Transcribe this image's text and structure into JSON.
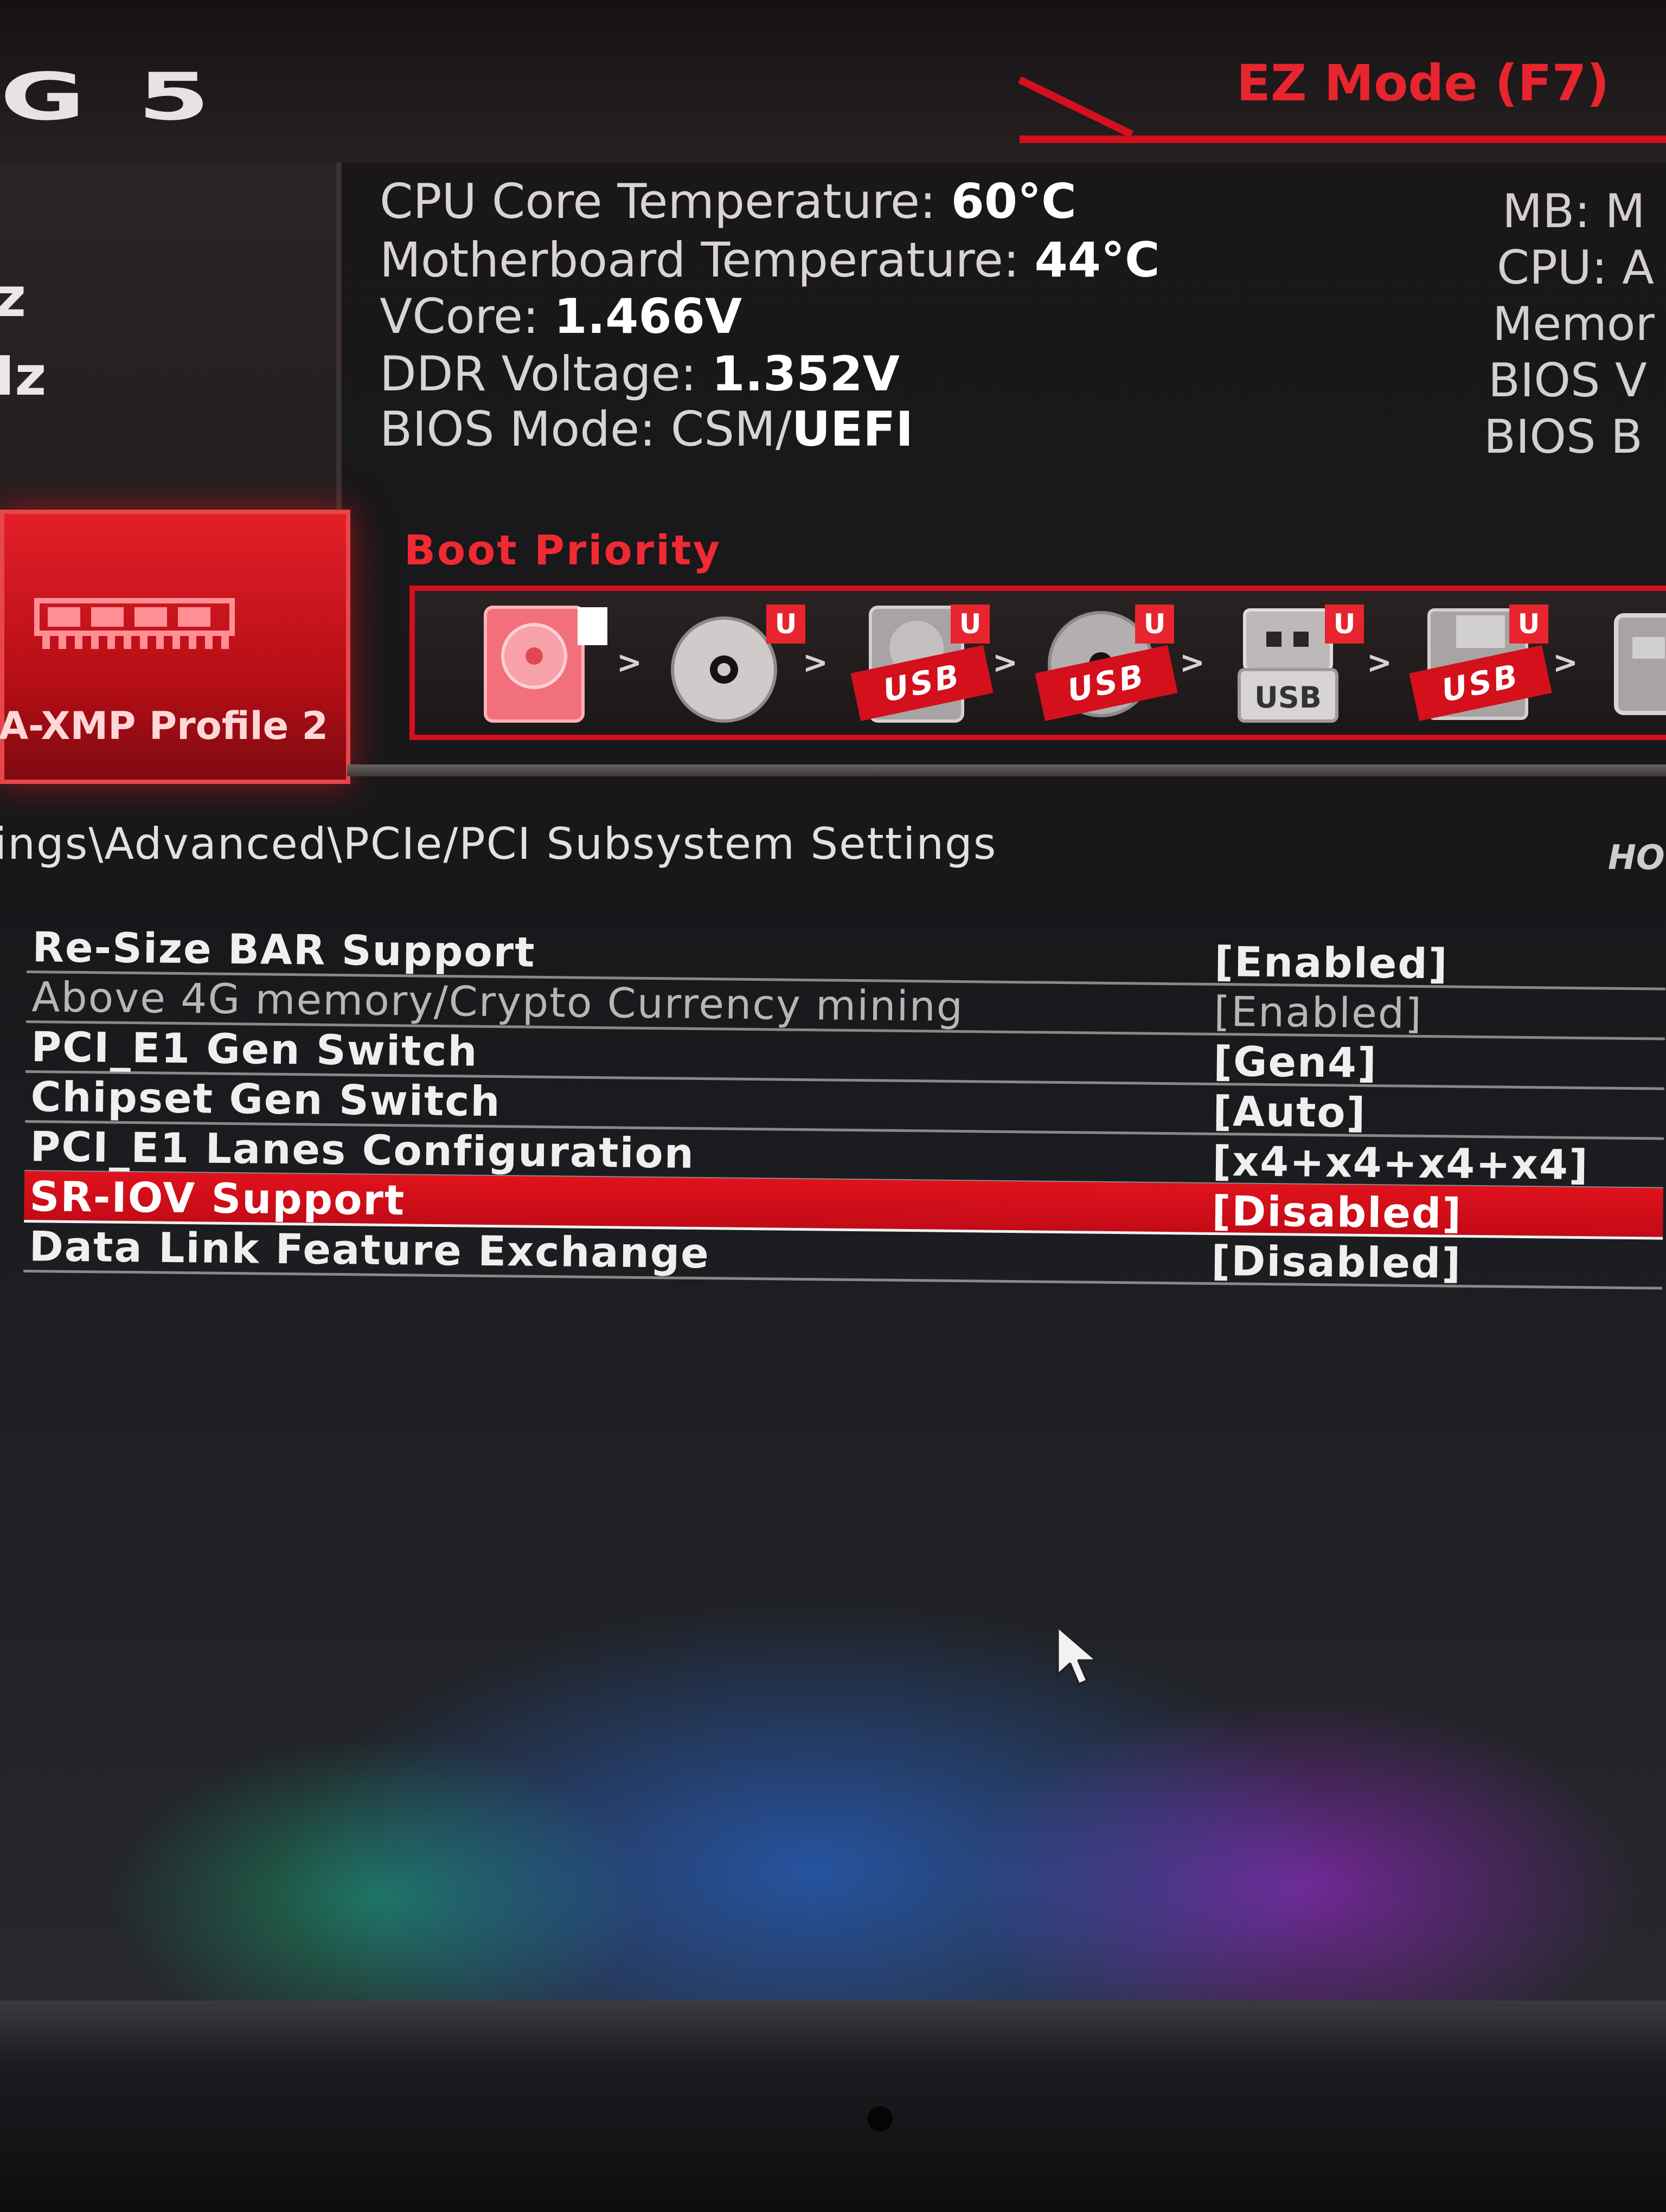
{
  "header": {
    "logo_text": "5",
    "logo_partial": "G",
    "ez_mode": "EZ Mode (F7)"
  },
  "left_panel": {
    "fragment_1": "z",
    "fragment_2": "Iz",
    "xmp_profile": "A-XMP Profile 2",
    "ram_icon": "memory-module-icon"
  },
  "system_info": {
    "cpu_temp_label": "CPU Core Temperature:",
    "cpu_temp_value": "60°C",
    "mb_temp_label": "Motherboard Temperature:",
    "mb_temp_value": "44°C",
    "vcore_label": "VCore:",
    "vcore_value": "1.466V",
    "ddr_label": "DDR Voltage:",
    "ddr_value": "1.352V",
    "bios_mode_label": "BIOS Mode:",
    "bios_mode_value": "CSM/",
    "bios_mode_value_bold": "UEFI"
  },
  "system_info_right": [
    "MB: M",
    "CPU: A",
    "Memor",
    "BIOS V",
    "BIOS B"
  ],
  "boot_priority": {
    "title": "Boot Priority",
    "devices": [
      {
        "icon": "hard-disk-icon",
        "label": ""
      },
      {
        "icon": "optical-disc-icon",
        "label": "",
        "badge": "U"
      },
      {
        "icon": "usb-hard-disk-icon",
        "label": "USB",
        "badge": "U"
      },
      {
        "icon": "usb-optical-disc-icon",
        "label": "USB",
        "badge": "U"
      },
      {
        "icon": "usb-key-icon",
        "label": "USB",
        "badge": "U"
      },
      {
        "icon": "usb-floppy-icon",
        "label": "USB",
        "badge": "U"
      },
      {
        "icon": "network-icon",
        "label": ""
      }
    ],
    "arrow": ">"
  },
  "breadcrumb": "ings\\Advanced\\PCIe/PCI Subsystem Settings",
  "hotkey": "HO",
  "settings": [
    {
      "label": "Re-Size BAR Support",
      "value": "[Enabled]"
    },
    {
      "label": "Above 4G memory/Crypto Currency mining",
      "value": "[Enabled]"
    },
    {
      "label": "PCI_E1 Gen Switch",
      "value": "[Gen4]"
    },
    {
      "label": "Chipset Gen Switch",
      "value": "[Auto]"
    },
    {
      "label": "PCI_E1 Lanes Configuration",
      "value": "[x4+x4+x4+x4]"
    },
    {
      "label": "SR-IOV Support",
      "value": "[Disabled]"
    },
    {
      "label": "Data Link Feature Exchange",
      "value": "[Disabled]"
    }
  ],
  "colors": {
    "accent": "#d3101c",
    "selected_row": "#e0121d"
  }
}
